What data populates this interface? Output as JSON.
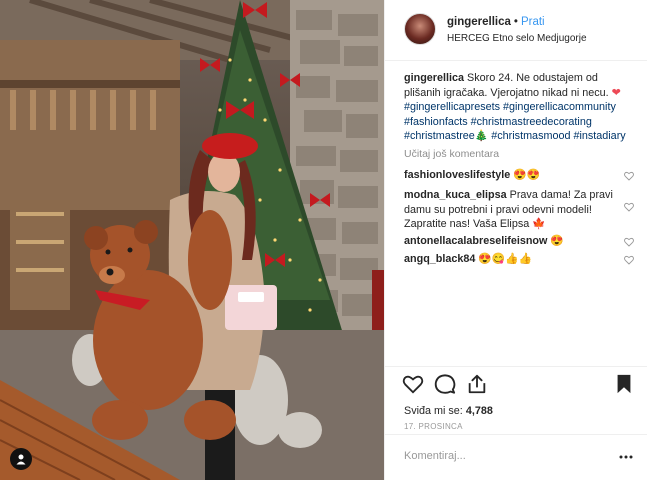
{
  "header": {
    "username": "gingerellica",
    "dot": "•",
    "follow_label": "Prati",
    "location": "HERCEG Etno selo Medjugorje"
  },
  "caption": {
    "username": "gingerellica",
    "text": "Skoro 24. Ne odustajem od plišanih igračaka. Vjerojatno nikad ni necu.",
    "heart_emoji": "❤",
    "tags_1": "#gingerellicapresets #gingerellicacommunity",
    "tags_2": "#fashionfacts #christmastreedecorating",
    "tag_tree": "#christmastree",
    "tree_emoji": "🎄",
    "tags_3b": "#christmasmood #instadiary"
  },
  "load_more_label": "Učitaj još komentara",
  "comments": [
    {
      "username": "fashionloveslifestyle",
      "text": "😍😍"
    },
    {
      "username": "modna_kuca_elipsa",
      "text": "Prava dama! Za pravi damu su potrebni i pravi odevni modeli! Zapratite nas! Vaša Elipsa 🍁"
    },
    {
      "username": "antonellacalabreselifeisnow",
      "text": "😍"
    },
    {
      "username": "angq_black84",
      "text": "😍😋👍👍"
    }
  ],
  "actions": {
    "likes_label": "Sviđa mi se:",
    "likes_count": "4,788",
    "date": "17. PROSINCA"
  },
  "comment_box": {
    "placeholder": "Komentiraj..."
  },
  "icons": {
    "like": "heart-outline-icon",
    "comment": "speech-bubble-icon",
    "share": "share-upload-icon",
    "save": "bookmark-filled-icon",
    "more": "ellipsis-icon",
    "user_tag": "person-icon"
  },
  "colors": {
    "link_blue": "#3897f0",
    "hashtag": "#003569",
    "muted": "#8e8e8e",
    "border": "#efefef"
  }
}
